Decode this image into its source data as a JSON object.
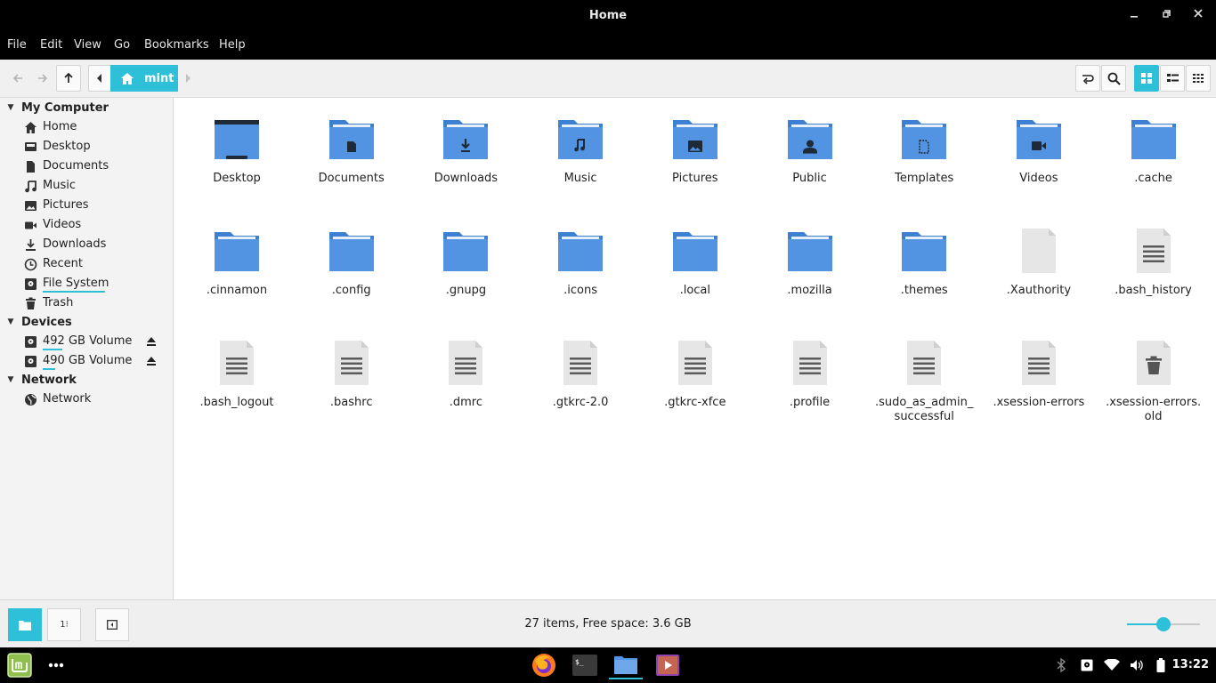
{
  "window": {
    "title": "Home"
  },
  "menu": [
    "File",
    "Edit",
    "View",
    "Go",
    "Bookmarks",
    "Help"
  ],
  "breadcrumb": {
    "current": "mint"
  },
  "sidebar": {
    "sections": [
      {
        "title": "My Computer",
        "items": [
          {
            "label": "Home",
            "icon": "home-icon"
          },
          {
            "label": "Desktop",
            "icon": "desktop-icon"
          },
          {
            "label": "Documents",
            "icon": "document-icon"
          },
          {
            "label": "Music",
            "icon": "music-icon"
          },
          {
            "label": "Pictures",
            "icon": "picture-icon"
          },
          {
            "label": "Videos",
            "icon": "video-icon"
          },
          {
            "label": "Downloads",
            "icon": "download-icon"
          },
          {
            "label": "Recent",
            "icon": "clock-icon"
          },
          {
            "label": "File System",
            "icon": "drive-icon"
          },
          {
            "label": "Trash",
            "icon": "trash-icon"
          }
        ]
      },
      {
        "title": "Devices",
        "items": [
          {
            "label": "492 GB Volume",
            "icon": "drive-icon",
            "eject": true
          },
          {
            "label": "490 GB Volume",
            "icon": "drive-icon",
            "eject": true
          }
        ]
      },
      {
        "title": "Network",
        "items": [
          {
            "label": "Network",
            "icon": "globe-icon"
          }
        ]
      }
    ]
  },
  "files": [
    {
      "name": "Desktop",
      "type": "desktop-folder"
    },
    {
      "name": "Documents",
      "type": "folder",
      "emblem": "document"
    },
    {
      "name": "Downloads",
      "type": "folder",
      "emblem": "download"
    },
    {
      "name": "Music",
      "type": "folder",
      "emblem": "music"
    },
    {
      "name": "Pictures",
      "type": "folder",
      "emblem": "picture"
    },
    {
      "name": "Public",
      "type": "folder",
      "emblem": "user"
    },
    {
      "name": "Templates",
      "type": "folder",
      "emblem": "template"
    },
    {
      "name": "Videos",
      "type": "folder",
      "emblem": "video"
    },
    {
      "name": ".cache",
      "type": "folder"
    },
    {
      "name": ".cinnamon",
      "type": "folder"
    },
    {
      "name": ".config",
      "type": "folder"
    },
    {
      "name": ".gnupg",
      "type": "folder"
    },
    {
      "name": ".icons",
      "type": "folder"
    },
    {
      "name": ".local",
      "type": "folder"
    },
    {
      "name": ".mozilla",
      "type": "folder"
    },
    {
      "name": ".themes",
      "type": "folder"
    },
    {
      "name": ".Xauthority",
      "type": "blank"
    },
    {
      "name": ".bash_history",
      "type": "text"
    },
    {
      "name": ".bash_logout",
      "type": "text"
    },
    {
      "name": ".bashrc",
      "type": "text"
    },
    {
      "name": ".dmrc",
      "type": "text"
    },
    {
      "name": ".gtkrc-2.0",
      "type": "text"
    },
    {
      "name": ".gtkrc-xfce",
      "type": "text"
    },
    {
      "name": ".profile",
      "type": "text"
    },
    {
      "name": ".sudo_as_admin_\nsuccessful",
      "type": "text"
    },
    {
      "name": ".xsession-errors",
      "type": "text"
    },
    {
      "name": ".xsession-errors.\nold",
      "type": "trash-file"
    }
  ],
  "status": {
    "text": "27 items, Free space: 3.6 GB",
    "zoom_fraction": 0.5
  },
  "taskbar": {
    "clock": "13:22"
  },
  "colors": {
    "accent": "#2ec0d8",
    "folder": "#5294e2",
    "folder_tab": "#3d7fd1"
  }
}
